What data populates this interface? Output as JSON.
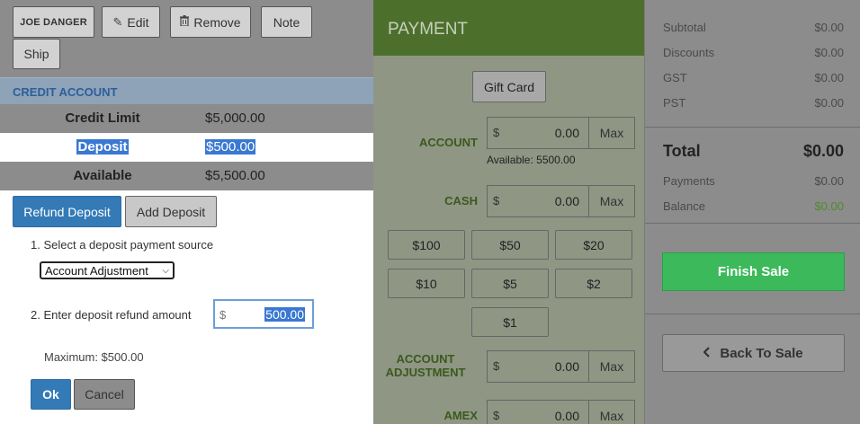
{
  "customer": {
    "name": "JOE DANGER",
    "edit_label": "Edit",
    "remove_label": "Remove",
    "note_label": "Note",
    "ship_label": "Ship"
  },
  "credit_account": {
    "header": "CREDIT ACCOUNT",
    "rows": [
      {
        "label": "Credit Limit",
        "value": "$5,000.00"
      },
      {
        "label": "Deposit",
        "value": "$500.00"
      },
      {
        "label": "Available",
        "value": "$5,500.00"
      }
    ]
  },
  "refund": {
    "refund_tab": "Refund Deposit",
    "add_tab": "Add Deposit",
    "step1": "1. Select a deposit payment source",
    "source_selected": "Account Adjustment",
    "step2": "2. Enter deposit refund amount",
    "amount_currency": "$",
    "amount_value": "500.00",
    "maximum": "Maximum: $500.00",
    "ok_label": "Ok",
    "cancel_label": "Cancel"
  },
  "payment": {
    "title": "PAYMENT",
    "gift_card": "Gift Card",
    "account": {
      "label": "ACCOUNT",
      "currency": "$",
      "value": "0.00",
      "max": "Max",
      "available": "Available: 5500.00"
    },
    "cash": {
      "label": "CASH",
      "currency": "$",
      "value": "0.00",
      "max": "Max"
    },
    "cash_buttons": [
      "$100",
      "$50",
      "$20",
      "$10",
      "$5",
      "$2",
      "$1"
    ],
    "account_adjustment": {
      "label_line1": "ACCOUNT",
      "label_line2": "ADJUSTMENT",
      "currency": "$",
      "value": "0.00",
      "max": "Max"
    },
    "amex": {
      "label": "AMEX",
      "currency": "$",
      "value": "0.00",
      "max": "Max"
    }
  },
  "summary": {
    "subtotal_label": "Subtotal",
    "subtotal": "$0.00",
    "discounts_label": "Discounts",
    "discounts": "$0.00",
    "gst_label": "GST",
    "gst": "$0.00",
    "pst_label": "PST",
    "pst": "$0.00",
    "total_label": "Total",
    "total": "$0.00",
    "payments_label": "Payments",
    "payments": "$0.00",
    "balance_label": "Balance",
    "balance": "$0.00",
    "balance_color": "#4f8a2d",
    "finish_label": "Finish Sale",
    "back_label": "Back To Sale"
  }
}
